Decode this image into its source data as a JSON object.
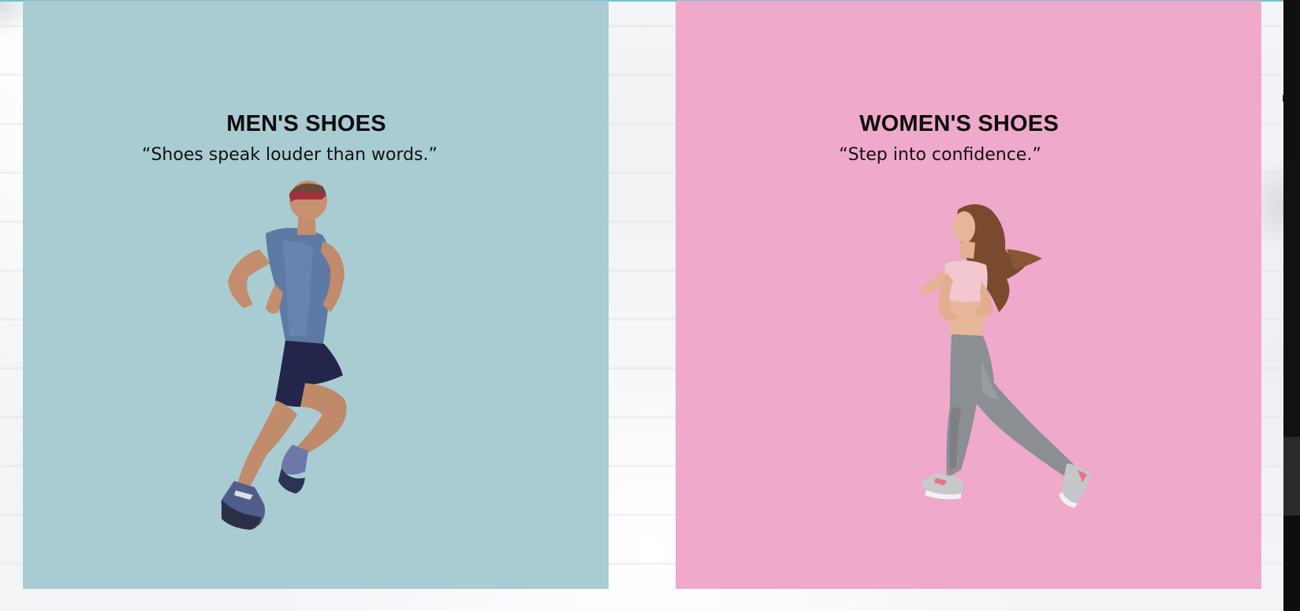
{
  "sections": {
    "men": {
      "title": "MEN'S SHOES",
      "quote": "“Shoes speak louder than words.”",
      "background_color": "#a9ccd3"
    },
    "women": {
      "title": "WOMEN'S SHOES",
      "quote": "“Step into confidence.”",
      "background_color": "#efa9cb"
    }
  },
  "edge_fragment": {
    "text": "nd"
  },
  "colors": {
    "page_background": "#f2f3f5",
    "accent_line": "#6fc3cc"
  }
}
